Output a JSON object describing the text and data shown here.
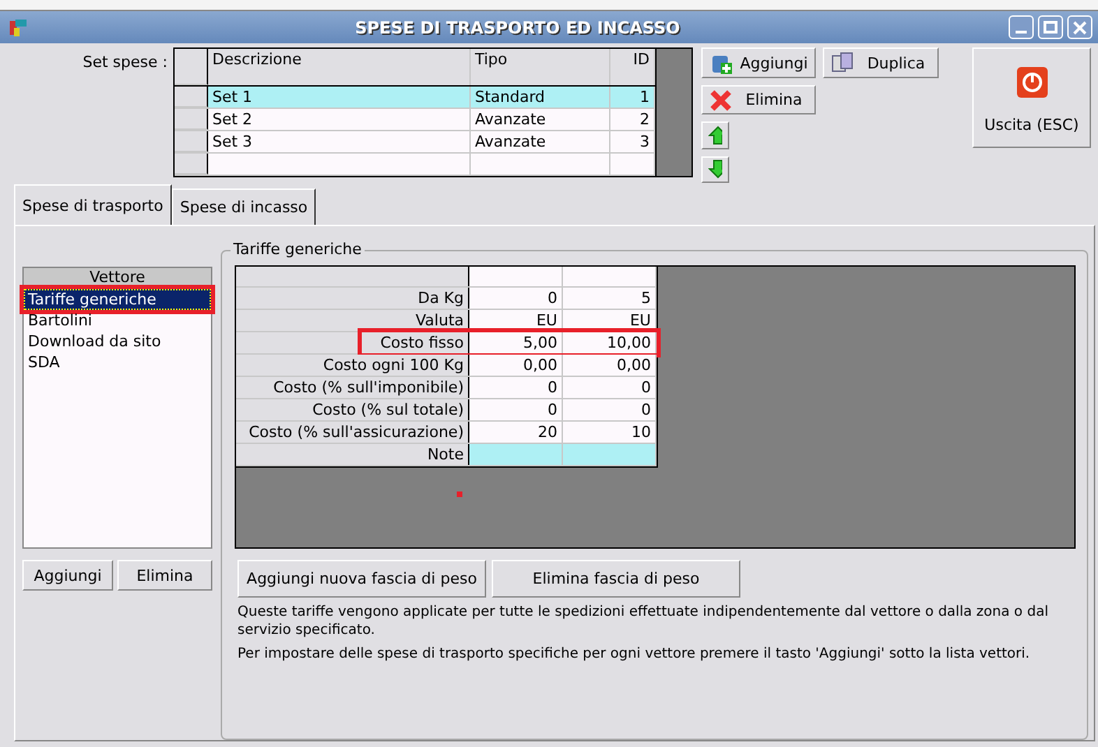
{
  "window": {
    "title": "SPESE DI TRASPORTO ED INCASSO"
  },
  "set_spese": {
    "label": "Set spese :",
    "columns": [
      "Descrizione",
      "Tipo",
      "ID"
    ],
    "rows": [
      {
        "cells": [
          "Set 1",
          "Standard",
          "1"
        ],
        "selected": true
      },
      {
        "cells": [
          "Set 2",
          "Avanzate",
          "2"
        ],
        "selected": false
      },
      {
        "cells": [
          "Set 3",
          "Avanzate",
          "3"
        ],
        "selected": false
      }
    ]
  },
  "set_buttons": {
    "add": "Aggiungi",
    "duplicate": "Duplica",
    "delete": "Elimina"
  },
  "exit_button": "Uscita (ESC)",
  "tabs": [
    {
      "label": "Spese di trasporto",
      "selected": true
    },
    {
      "label": "Spese di incasso",
      "selected": false
    }
  ],
  "carriers": {
    "header": "Vettore",
    "items": [
      {
        "label": "Tariffe generiche",
        "selected": true,
        "highlighted": true
      },
      {
        "label": "Bartolini",
        "selected": false,
        "highlighted": false
      },
      {
        "label": "Download da sito",
        "selected": false,
        "highlighted": false
      },
      {
        "label": "SDA",
        "selected": false,
        "highlighted": false
      }
    ],
    "buttons": [
      "Aggiungi",
      "Elimina"
    ]
  },
  "rates": {
    "title": "Tariffe generiche",
    "rows": [
      {
        "label": "Da Kg",
        "values": [
          "0",
          "5"
        ],
        "highlighted": false
      },
      {
        "label": "Valuta",
        "values": [
          "EU",
          "EU"
        ],
        "highlighted": false
      },
      {
        "label": "Costo fisso",
        "values": [
          "5,00",
          "10,00"
        ],
        "highlighted": true
      },
      {
        "label": "Costo ogni 100 Kg",
        "values": [
          "0,00",
          "0,00"
        ],
        "highlighted": false
      },
      {
        "label": "Costo (% sull'imponibile)",
        "values": [
          "0",
          "0"
        ],
        "highlighted": false
      },
      {
        "label": "Costo (% sul totale)",
        "values": [
          "0",
          "0"
        ],
        "highlighted": false
      },
      {
        "label": "Costo (% sull'assicurazione)",
        "values": [
          "20",
          "10"
        ],
        "highlighted": false
      },
      {
        "label": "Note",
        "highlighted": false,
        "kind": "note"
      }
    ],
    "buttons": [
      "Aggiungi nuova fascia di peso",
      "Elimina fascia di peso"
    ],
    "notes": [
      "Queste tariffe vengono applicate per tutte le spedizioni effettuate indipendentemente dal vettore o dalla zona o dal servizio specificato.",
      "Per impostare delle spese di trasporto specifiche per ogni vettore premere il tasto 'Aggiungi' sotto la lista vettori."
    ]
  }
}
